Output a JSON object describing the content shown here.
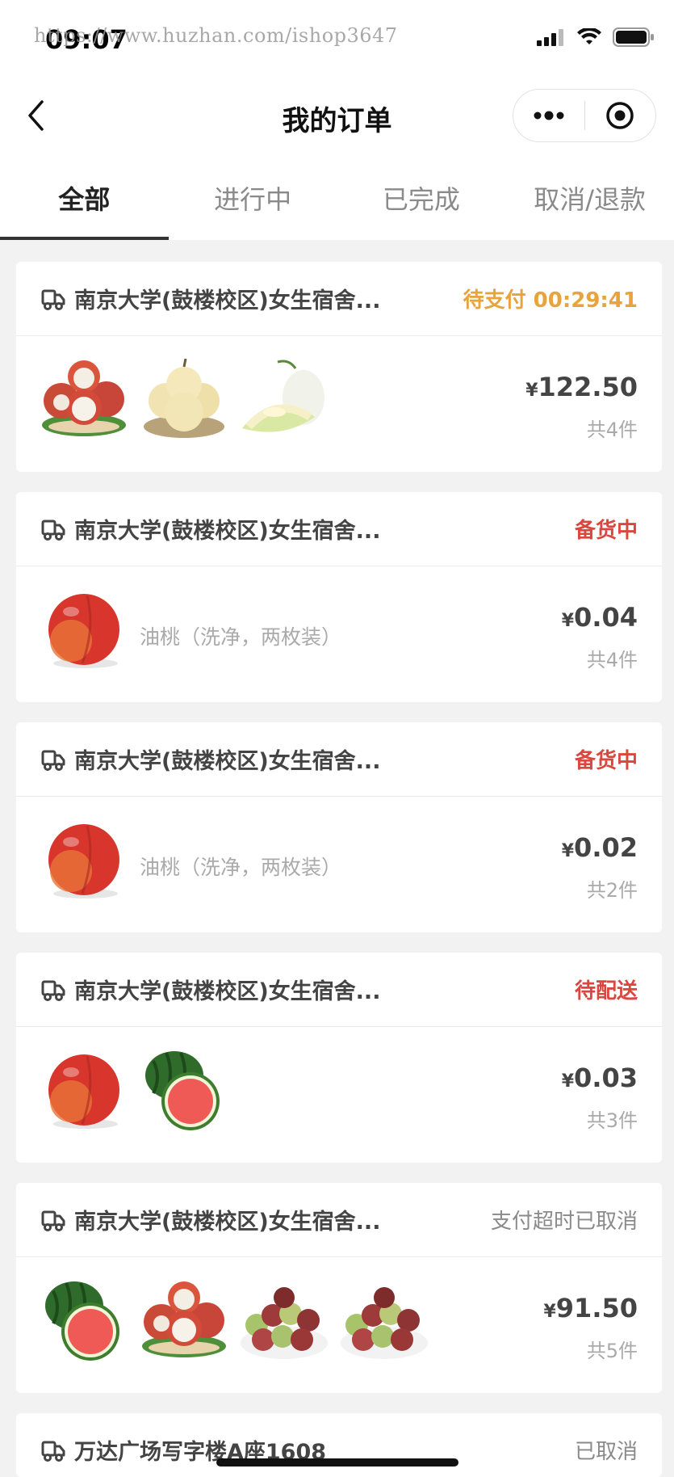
{
  "status_bar": {
    "time": "09:07",
    "watermark": "https://www.huzhan.com/ishop3647"
  },
  "nav": {
    "title": "我的订单"
  },
  "tabs": [
    "全部",
    "进行中",
    "已完成",
    "取消/退款"
  ],
  "orders": [
    {
      "address": "南京大学(鼓楼校区)女生宿舍...",
      "status": "待支付 00:29:41",
      "status_color": "#e8a33c",
      "items": [
        "lychee",
        "pear",
        "melon"
      ],
      "goods_name": "",
      "currency": "¥",
      "price": "122.50",
      "count": "共4件"
    },
    {
      "address": "南京大学(鼓楼校区)女生宿舍...",
      "status": "备货中",
      "status_color": "#d9473f",
      "items": [
        "nectarine"
      ],
      "goods_name": "油桃（洗净，两枚装）",
      "currency": "¥",
      "price": "0.04",
      "count": "共4件"
    },
    {
      "address": "南京大学(鼓楼校区)女生宿舍...",
      "status": "备货中",
      "status_color": "#d9473f",
      "items": [
        "nectarine"
      ],
      "goods_name": "油桃（洗净，两枚装）",
      "currency": "¥",
      "price": "0.02",
      "count": "共2件"
    },
    {
      "address": "南京大学(鼓楼校区)女生宿舍...",
      "status": "待配送",
      "status_color": "#d9473f",
      "items": [
        "nectarine",
        "watermelon"
      ],
      "goods_name": "",
      "currency": "¥",
      "price": "0.03",
      "count": "共3件"
    },
    {
      "address": "南京大学(鼓楼校区)女生宿舍...",
      "status": "支付超时已取消",
      "status_color": "#8a8a8a",
      "items": [
        "watermelon",
        "lychee",
        "plums",
        "plums"
      ],
      "goods_name": "",
      "currency": "¥",
      "price": "91.50",
      "count": "共5件"
    },
    {
      "address": "万达广场写字楼A座1608",
      "status": "已取消",
      "status_color": "#8a8a8a"
    }
  ]
}
